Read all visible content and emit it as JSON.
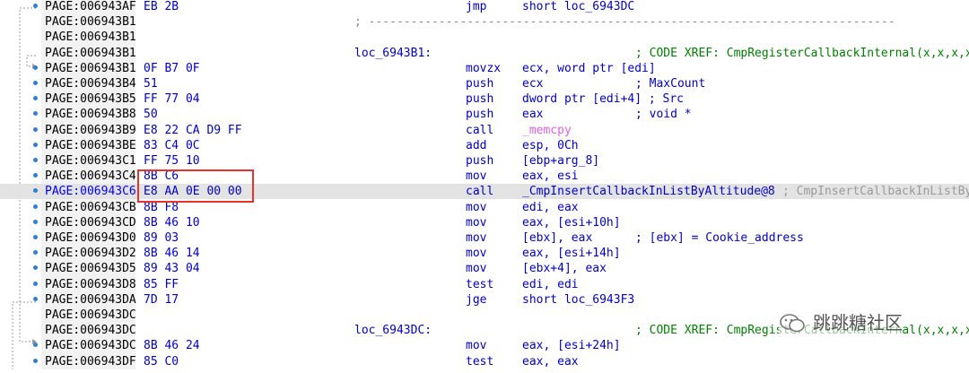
{
  "listing": [
    {
      "addr": "PAGE:006943AF",
      "bytes": "EB 2B",
      "mnemonic": "jmp",
      "operands": "short loc_6943DC"
    },
    {
      "addr": "PAGE:006943B1",
      "separator": "; ---------------------------------------------------------------------------"
    },
    {
      "addr": "PAGE:006943B1"
    },
    {
      "addr": "PAGE:006943B1",
      "label": "loc_6943B1:",
      "xref": "; CODE XREF: CmpRegisterCallbackInternal(x,x,x,x"
    },
    {
      "addr": "PAGE:006943B1",
      "bytes": "0F B7 0F",
      "mnemonic": "movzx",
      "operands": "ecx, word ptr [edi]"
    },
    {
      "addr": "PAGE:006943B4",
      "bytes": "51",
      "mnemonic": "push",
      "operands": "ecx",
      "comment": "; MaxCount"
    },
    {
      "addr": "PAGE:006943B5",
      "bytes": "FF 77 04",
      "mnemonic": "push",
      "operands": "dword ptr [edi+4] ; Src"
    },
    {
      "addr": "PAGE:006943B8",
      "bytes": "50",
      "mnemonic": "push",
      "operands": "eax",
      "comment": "; void *"
    },
    {
      "addr": "PAGE:006943B9",
      "bytes": "E8 22 CA D9 FF",
      "mnemonic": "call",
      "operands": "_memcpy"
    },
    {
      "addr": "PAGE:006943BE",
      "bytes": "83 C4 0C",
      "mnemonic": "add",
      "operands": "esp, 0Ch"
    },
    {
      "addr": "PAGE:006943C1",
      "bytes": "FF 75 10",
      "mnemonic": "push",
      "operands": "[ebp+arg_8]"
    },
    {
      "addr": "PAGE:006943C4",
      "bytes": "8B C6",
      "mnemonic": "mov",
      "operands": "eax, esi"
    },
    {
      "addr": "PAGE:006943C6",
      "bytes": "E8 AA 0E 00 00",
      "mnemonic": "call",
      "operands": "_CmpInsertCallbackInListByAltitude@8",
      "comment": "; CmpInsertCallbackInListBy"
    },
    {
      "addr": "PAGE:006943CB",
      "bytes": "8B F8",
      "mnemonic": "mov",
      "operands": "edi, eax"
    },
    {
      "addr": "PAGE:006943CD",
      "bytes": "8B 46 10",
      "mnemonic": "mov",
      "operands": "eax, [esi+10h]"
    },
    {
      "addr": "PAGE:006943D0",
      "bytes": "89 03",
      "mnemonic": "mov",
      "operands": "[ebx], eax",
      "comment": "; [ebx] = Cookie_address"
    },
    {
      "addr": "PAGE:006943D2",
      "bytes": "8B 46 14",
      "mnemonic": "mov",
      "operands": "eax, [esi+14h]"
    },
    {
      "addr": "PAGE:006943D5",
      "bytes": "89 43 04",
      "mnemonic": "mov",
      "operands": "[ebx+4], eax"
    },
    {
      "addr": "PAGE:006943D8",
      "bytes": "85 FF",
      "mnemonic": "test",
      "operands": "edi, edi"
    },
    {
      "addr": "PAGE:006943DA",
      "bytes": "7D 17",
      "mnemonic": "jge",
      "operands": "short loc_6943F3"
    },
    {
      "addr": "PAGE:006943DC"
    },
    {
      "addr": "PAGE:006943DC",
      "label": "loc_6943DC:",
      "xref": "; CODE XREF: CmpRegisterCallbackInternal(x,x,x,x"
    },
    {
      "addr": "PAGE:006943DC",
      "bytes": "8B 46 24",
      "mnemonic": "mov",
      "operands": "eax, [esi+24h]"
    },
    {
      "addr": "PAGE:006943DF",
      "bytes": "85 C0",
      "mnemonic": "test",
      "operands": "eax, eax"
    }
  ],
  "watermark": {
    "text": "跳跳糖社区"
  },
  "colors": {
    "highlight": "#e3e3e3",
    "redbox": "#e8322c",
    "mnemonic": "#0000c8",
    "xref": "#008000",
    "breakpoint": "#2f7fd3"
  }
}
